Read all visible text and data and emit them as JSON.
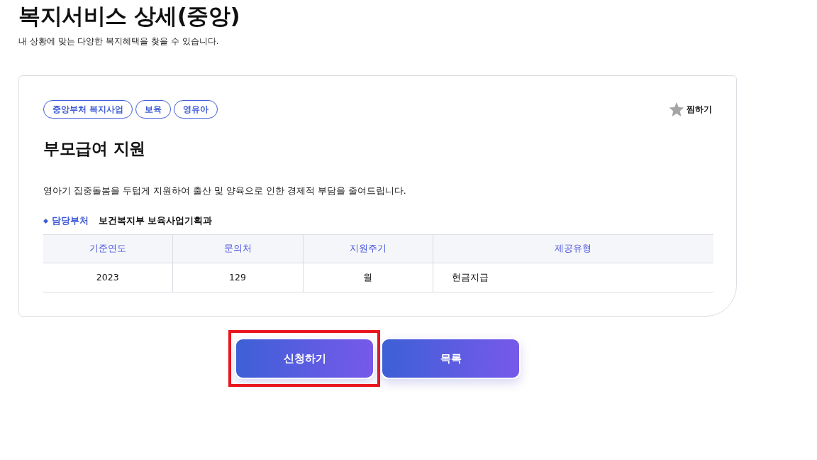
{
  "page": {
    "title": "복지서비스 상세(중앙)",
    "subtitle": "내 상황에 맞는 다양한 복지혜택을 찾을 수 있습니다."
  },
  "service": {
    "tags": [
      "중앙부처 복지사업",
      "보육",
      "영유아"
    ],
    "favorite": {
      "label": "찜하기",
      "on": false
    },
    "title": "부모급여 지원",
    "description": "영아기 집중돌봄을 두텁게 지원하여 출산 및 양육으로 인한 경제적 부담을 줄여드립니다.",
    "department": {
      "label": "담당부처",
      "value": "보건복지부 보육사업기획과"
    },
    "table": {
      "columns": [
        "기준연도",
        "문의처",
        "지원주기",
        "제공유형"
      ],
      "rows": [
        [
          "2023",
          "129",
          "월",
          "현금지급"
        ]
      ]
    }
  },
  "buttons": [
    {
      "label": "신청하기",
      "highlighted": true
    },
    {
      "label": "목록",
      "highlighted": false
    }
  ]
}
